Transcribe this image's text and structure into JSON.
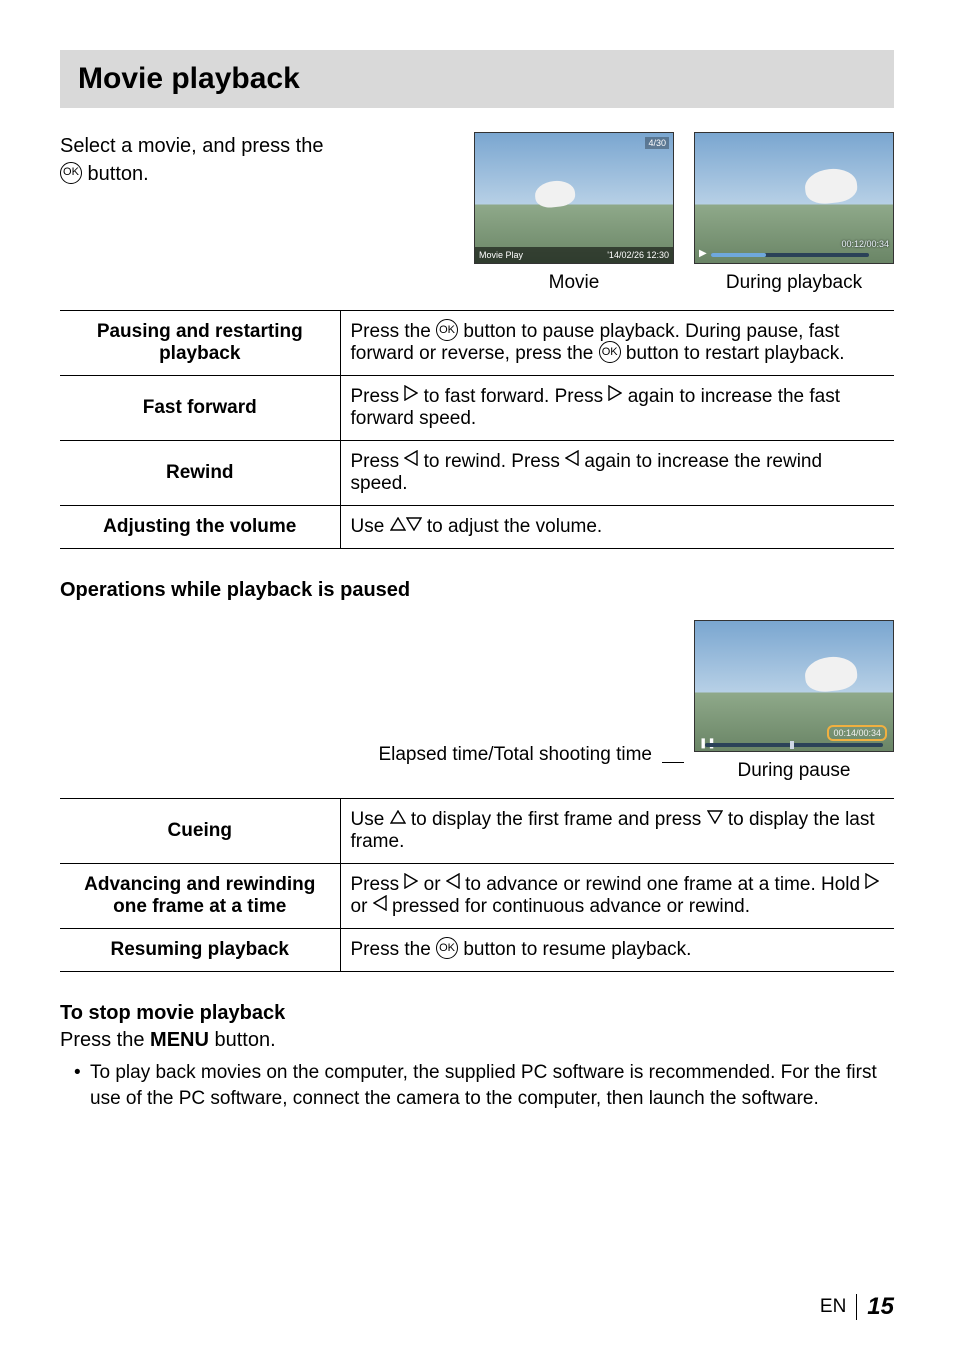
{
  "title": "Movie playback",
  "intro": {
    "line1": "Select a movie, and press the",
    "line2_pre": "",
    "ok": "OK",
    "line2_post": " button."
  },
  "previews": {
    "movie": {
      "counter": "4/30",
      "bar_left": "Movie Play",
      "bar_right": "'14/02/26  12:30",
      "caption": "Movie"
    },
    "playback": {
      "timer": "00:12/00:34",
      "caption": "During playback"
    }
  },
  "ops1": [
    {
      "head": "Pausing and restarting playback",
      "desc_pre": "Press the ",
      "ok1": "OK",
      "desc_mid": " button to pause playback. During pause, fast forward or reverse, press the ",
      "ok2": "OK",
      "desc_post": " button to restart playback."
    },
    {
      "head": "Fast forward",
      "desc": "Press ▷ to fast forward. Press ▷ again to increase the fast forward speed."
    },
    {
      "head": "Rewind",
      "desc": "Press ◁ to rewind. Press ◁ again to increase the rewind speed."
    },
    {
      "head": "Adjusting the volume",
      "desc": "Use △▽ to adjust the volume."
    }
  ],
  "pausehead": "Operations while playback is paused",
  "pauselabel": "Elapsed time/Total shooting time",
  "pausecaption": "During pause",
  "pausetimer": "00:14/00:34",
  "ops2": [
    {
      "head": "Cueing",
      "desc": "Use △ to display the first frame and press ▽ to display the last frame."
    },
    {
      "head": "Advancing and rewinding one frame at a time",
      "desc": "Press ▷ or ◁ to advance or rewind one frame at a time. Hold ▷ or ◁ pressed for continuous advance or rewind."
    },
    {
      "head": "Resuming playback",
      "desc_pre": "Press the ",
      "ok": "OK",
      "desc_post": " button to resume playback."
    }
  ],
  "stop": {
    "head": "To stop movie playback",
    "press_pre": "Press the ",
    "menu": "MENU",
    "press_post": " button.",
    "note": "To play back movies on the computer, the supplied PC software is recommended. For the first use of the PC software, connect the camera to the computer, then launch the software."
  },
  "footer": {
    "lang": "EN",
    "page": "15"
  }
}
